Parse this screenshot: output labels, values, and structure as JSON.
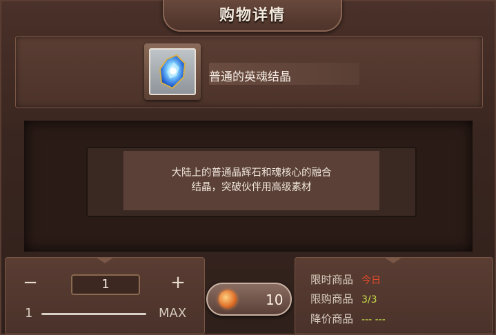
{
  "title": "购物详情",
  "item": {
    "name": "普通的英魂结晶",
    "icon": "crystal-icon"
  },
  "description": {
    "line1": "大陆上的普通晶辉石和魂核心的融合",
    "line2": "结晶，突破伙伴用高级素材"
  },
  "quantity": {
    "minus": "−",
    "plus": "+",
    "value": "1",
    "min_label": "1",
    "max_label": "MAX"
  },
  "buy": {
    "price": "10",
    "currency_icon": "coin-icon"
  },
  "info": [
    {
      "label": "限时商品",
      "value": "今日",
      "color": "#e84a2a"
    },
    {
      "label": "限购商品",
      "value": "3/3",
      "color": "#c8e04a"
    },
    {
      "label": "降价商品",
      "value": "--- ---",
      "color": "#c8e04a"
    }
  ]
}
